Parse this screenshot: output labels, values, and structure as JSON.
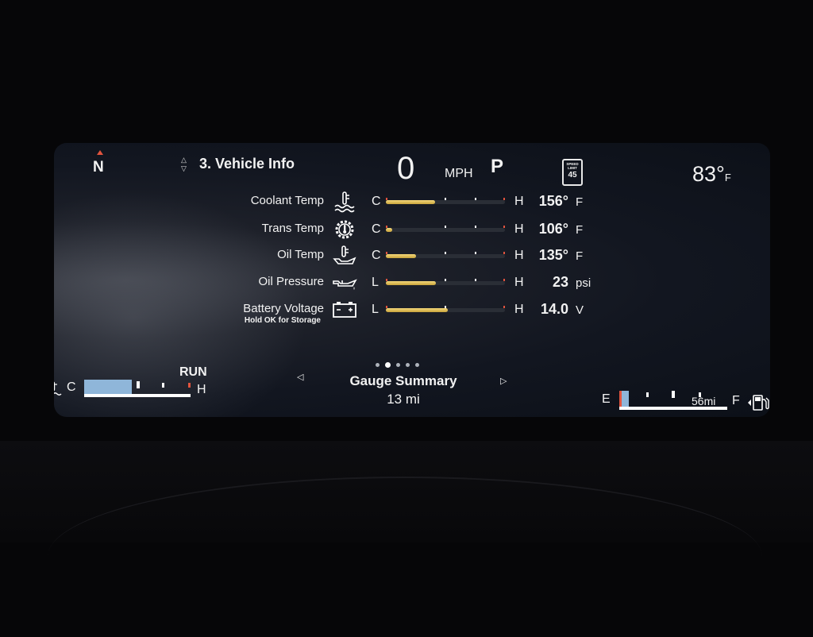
{
  "top_bar": {
    "compass": "N",
    "menu_title": "3. Vehicle Info",
    "speed": "0",
    "speed_unit": "MPH",
    "gear": "P",
    "speed_limit_label": "SPEED LIMIT",
    "speed_limit_value": "45",
    "outside_temp": "83°",
    "outside_temp_unit": "F"
  },
  "gauges": [
    {
      "label": "Coolant Temp",
      "icon": "coolant-temp-icon",
      "low": "C",
      "high": "H",
      "value": "156°",
      "unit": "F",
      "level": 0.41
    },
    {
      "label": "Trans Temp",
      "icon": "transmission-temp-icon",
      "low": "C",
      "high": "H",
      "value": "106°",
      "unit": "F",
      "level": 0.05
    },
    {
      "label": "Oil Temp",
      "icon": "oil-temp-icon",
      "low": "C",
      "high": "H",
      "value": "135°",
      "unit": "F",
      "level": 0.25
    },
    {
      "label": "Oil Pressure",
      "icon": "oil-pressure-icon",
      "low": "L",
      "high": "H",
      "value": "23",
      "unit": "psi",
      "level": 0.42
    },
    {
      "label": "Battery Voltage",
      "sublabel": "Hold OK for Storage",
      "icon": "battery-icon",
      "low": "L",
      "high": "H",
      "value": "14.0",
      "unit": "V",
      "level": 0.52
    }
  ],
  "bottom": {
    "engine_low": "C",
    "engine_high": "H",
    "engine_state": "RUN",
    "engine_level": 0.45,
    "page_title": "Gauge Summary",
    "page_subtitle": "13 mi",
    "page_count": 5,
    "active_page": 1,
    "fuel_empty": "E",
    "fuel_full": "F",
    "fuel_range": "56mi",
    "fuel_level": 0.08
  },
  "colors": {
    "gauge_fill": "#d8b44a",
    "warning_tick": "#e2543e",
    "temp_fill": "#8fb6d9"
  }
}
